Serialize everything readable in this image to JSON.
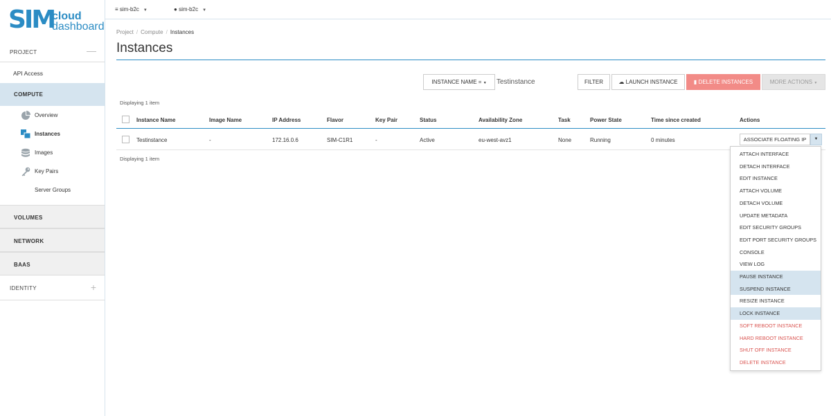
{
  "brand": {
    "mark": "SIM",
    "line1": "cloud",
    "line2": "dashboard",
    "color": "#2b8cc4"
  },
  "topbar": {
    "project_selector": "sim-b2c",
    "user_menu": "sim-b2c"
  },
  "sidebar": {
    "project": "PROJECT",
    "api_access": "API Access",
    "compute": "COMPUTE",
    "compute_items": [
      {
        "label": "Overview",
        "icon": "pie-chart-icon"
      },
      {
        "label": "Instances",
        "icon": "instances-icon"
      },
      {
        "label": "Images",
        "icon": "database-icon"
      },
      {
        "label": "Key Pairs",
        "icon": "key-icon"
      },
      {
        "label": "Server Groups",
        "icon": ""
      }
    ],
    "volumes": "VOLUMES",
    "network": "NETWORK",
    "baas": "BAAS",
    "identity": "IDENTITY"
  },
  "breadcrumb": [
    "Project",
    "Compute",
    "Instances"
  ],
  "page_title": "Instances",
  "toolbar": {
    "filter_field": "INSTANCE NAME =",
    "filter_value": "Testinstance",
    "filter": "FILTER",
    "launch": "LAUNCH INSTANCE",
    "delete": "DELETE INSTANCES",
    "more": "MORE ACTIONS"
  },
  "table": {
    "count_text": "Displaying 1 item",
    "columns": [
      "Instance Name",
      "Image Name",
      "IP Address",
      "Flavor",
      "Key Pair",
      "Status",
      "Availability Zone",
      "Task",
      "Power State",
      "Time since created",
      "Actions"
    ],
    "rows": [
      [
        "Testinstance",
        "-",
        "172.16.0.6",
        "SIM-C1R1",
        "-",
        "Active",
        "eu-west-avz1",
        "None",
        "Running",
        "0 minutes"
      ]
    ],
    "row_action": "ASSOCIATE FLOATING IP"
  },
  "actions_menu": [
    "ATTACH INTERFACE",
    "DETACH INTERFACE",
    "EDIT INSTANCE",
    "ATTACH VOLUME",
    "DETACH VOLUME",
    "UPDATE METADATA",
    "EDIT SECURITY GROUPS",
    "EDIT PORT SECURITY GROUPS",
    "CONSOLE",
    "VIEW LOG",
    "PAUSE INSTANCE",
    "SUSPEND INSTANCE",
    "RESIZE INSTANCE",
    "LOCK INSTANCE",
    "SOFT REBOOT INSTANCE",
    "HARD REBOOT INSTANCE",
    "SHUT OFF INSTANCE",
    "DELETE INSTANCE"
  ],
  "colors": {
    "accent": "#2b8cc4",
    "active_bg": "#d5e4ef",
    "danger": "#d9534f",
    "delete_button": "#f28b87"
  }
}
